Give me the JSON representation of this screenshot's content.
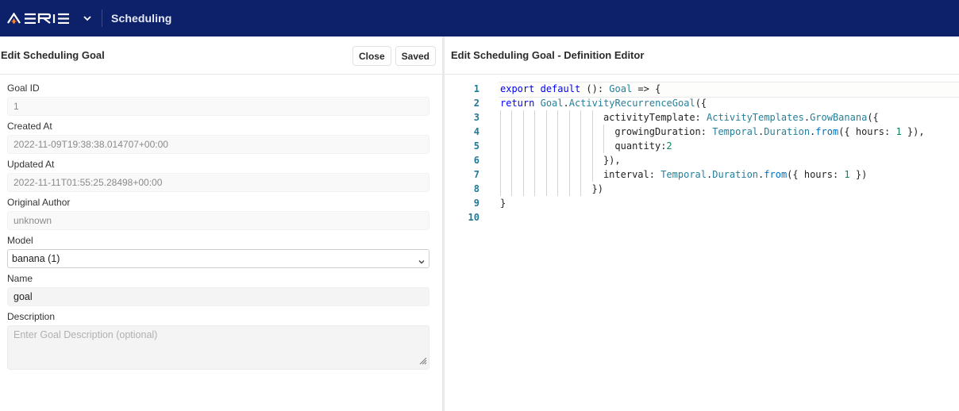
{
  "topbar": {
    "logo_text": "AERIE",
    "app_title": "Scheduling",
    "brand_color": "#0d216b",
    "accent_color": "#f58233"
  },
  "left_panel": {
    "title": "Edit Scheduling Goal",
    "close_label": "Close",
    "saved_label": "Saved",
    "fields": {
      "goal_id": {
        "label": "Goal ID",
        "value": "1"
      },
      "created_at": {
        "label": "Created At",
        "value": "2022-11-09T19:38:38.014707+00:00"
      },
      "updated_at": {
        "label": "Updated At",
        "value": "2022-11-11T01:55:25.28498+00:00"
      },
      "original_author": {
        "label": "Original Author",
        "value": "unknown"
      },
      "model": {
        "label": "Model",
        "selected": "banana (1)"
      },
      "name": {
        "label": "Name",
        "value": "goal"
      },
      "description": {
        "label": "Description",
        "value": "",
        "placeholder": "Enter Goal Description (optional)"
      }
    }
  },
  "right_panel": {
    "title": "Edit Scheduling Goal - Definition Editor",
    "code_lines": [
      {
        "n": "1",
        "indent": 0,
        "guides": 0,
        "tokens": [
          [
            "kw",
            "export"
          ],
          [
            "",
            ""
          ],
          [
            "",
            " "
          ],
          [
            "kw",
            "default"
          ],
          [
            "",
            " (): "
          ],
          [
            "ty",
            "Goal"
          ],
          [
            "",
            " => {"
          ]
        ]
      },
      {
        "n": "2",
        "indent": 0,
        "guides": 0,
        "tokens": [
          [
            "kw",
            "return"
          ],
          [
            "",
            " "
          ],
          [
            "ty",
            "Goal"
          ],
          [
            "",
            "."
          ],
          [
            "ty",
            "ActivityRecurrenceGoal"
          ],
          [
            "",
            "({"
          ]
        ]
      },
      {
        "n": "3",
        "indent": 18,
        "guides": 9,
        "tokens": [
          [
            "",
            "activityTemplate: "
          ],
          [
            "ty",
            "ActivityTemplates"
          ],
          [
            "",
            "."
          ],
          [
            "ty",
            "GrowBanana"
          ],
          [
            "",
            "({"
          ]
        ]
      },
      {
        "n": "4",
        "indent": 20,
        "guides": 10,
        "tokens": [
          [
            "",
            "growingDuration: "
          ],
          [
            "ty",
            "Temporal"
          ],
          [
            "",
            "."
          ],
          [
            "ty",
            "Duration"
          ],
          [
            "",
            "."
          ],
          [
            "fn",
            "from"
          ],
          [
            "",
            "({ hours: "
          ],
          [
            "nm",
            "1"
          ],
          [
            "",
            " }),"
          ]
        ]
      },
      {
        "n": "5",
        "indent": 20,
        "guides": 10,
        "tokens": [
          [
            "",
            "quantity:"
          ],
          [
            "nm",
            "2"
          ]
        ]
      },
      {
        "n": "6",
        "indent": 18,
        "guides": 9,
        "tokens": [
          [
            "",
            "}),"
          ]
        ]
      },
      {
        "n": "7",
        "indent": 18,
        "guides": 9,
        "tokens": [
          [
            "",
            "interval: "
          ],
          [
            "ty",
            "Temporal"
          ],
          [
            "",
            "."
          ],
          [
            "ty",
            "Duration"
          ],
          [
            "",
            "."
          ],
          [
            "fn",
            "from"
          ],
          [
            "",
            "({ hours: "
          ],
          [
            "nm",
            "1"
          ],
          [
            "",
            " })"
          ]
        ]
      },
      {
        "n": "8",
        "indent": 16,
        "guides": 8,
        "tokens": [
          [
            "",
            "})"
          ]
        ]
      },
      {
        "n": "9",
        "indent": 0,
        "guides": 0,
        "tokens": [
          [
            "",
            "}"
          ]
        ]
      },
      {
        "n": "10",
        "indent": 0,
        "guides": 0,
        "tokens": []
      }
    ]
  }
}
